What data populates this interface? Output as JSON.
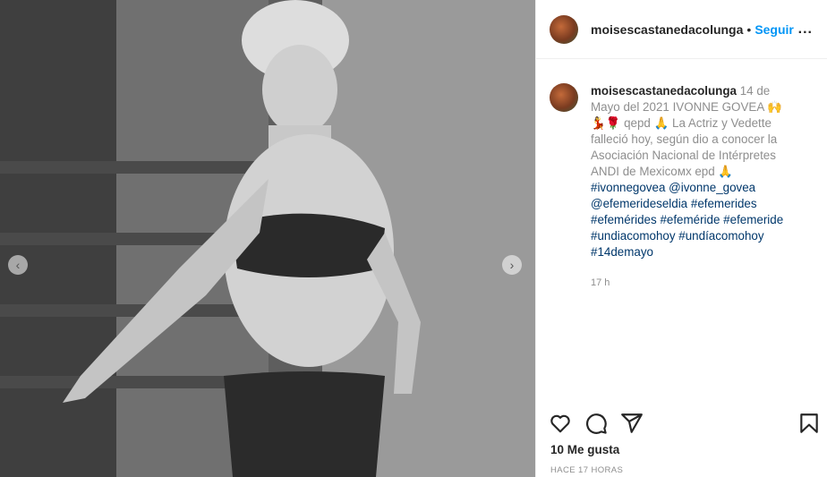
{
  "post": {
    "username": "moisescastanedacolunga",
    "separator": "•",
    "follow_label": "Seguir",
    "more_label": "...",
    "caption": {
      "line1": "14 de Mayo del 2021 IVONNE GOVEA",
      "line1_emoji": "🙌💃🌹",
      "line2": "qepd 🙏 La Actriz y Vedette falleció hoy, según dio a conocer la Asociación Nacional de Intérpretes ANDI de Mexicoмx epd 🙏",
      "tags": [
        "#ivonnegovea",
        "@ivonne_govea",
        "@efemerideseldia",
        "#efemerides",
        "#efemérides",
        "#efeméride",
        "#efemeride",
        "#undiacomohoy",
        "#undíacomohoy",
        "#14demayo"
      ]
    },
    "caption_time": "17 h",
    "likes": "10 Me gusta",
    "posted_ago": "HACE 17 HORAS"
  },
  "carousel": {
    "prev_icon": "chevron-left-icon",
    "next_icon": "chevron-right-icon"
  },
  "icons": {
    "like": "heart-icon",
    "comment": "comment-bubble-icon",
    "share": "paper-plane-icon",
    "save": "bookmark-icon"
  },
  "colors": {
    "link": "#0095f6",
    "hashtag": "#00376b",
    "muted": "#8e8e8e",
    "text": "#262626"
  }
}
